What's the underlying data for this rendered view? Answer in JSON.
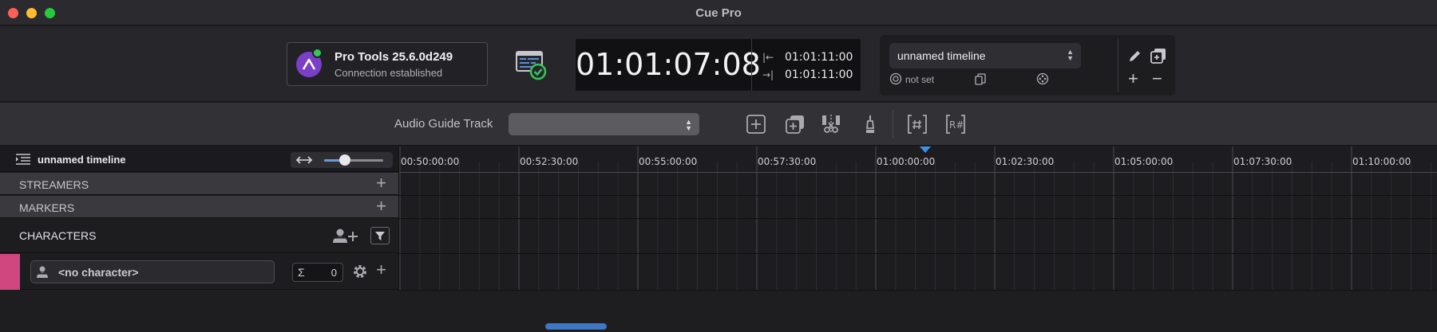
{
  "window": {
    "title": "Cue Pro"
  },
  "connection": {
    "app_name": "Pro Tools 25.6.0d249",
    "status": "Connection established",
    "status_color": "#34c759"
  },
  "timecode": {
    "current": "01:01:07:08",
    "in_point": "01:01:11:00",
    "out_point": "01:01:11:00"
  },
  "timeline_selector": {
    "selected": "unnamed timeline",
    "meta_not_set": "not set"
  },
  "toolbar2": {
    "audio_guide_label": "Audio Guide Track",
    "audio_guide_value": ""
  },
  "left_panel": {
    "title": "unnamed timeline",
    "zoom_level": 0.35,
    "sections": {
      "streamers": "STREAMERS",
      "markers": "MARKERS",
      "characters": "CHARACTERS"
    },
    "character": {
      "name": "<no character>",
      "count": "0",
      "color": "#d0477f"
    }
  },
  "ruler": {
    "labels": [
      "00:50:00:00",
      "00:52:30:00",
      "00:55:00:00",
      "00:57:30:00",
      "01:00:00:00",
      "01:02:30:00",
      "01:05:00:00",
      "01:07:30:00",
      "01:10:00:00"
    ]
  },
  "colors": {
    "accent": "#3d8fe8",
    "background": "#1e1e21"
  }
}
